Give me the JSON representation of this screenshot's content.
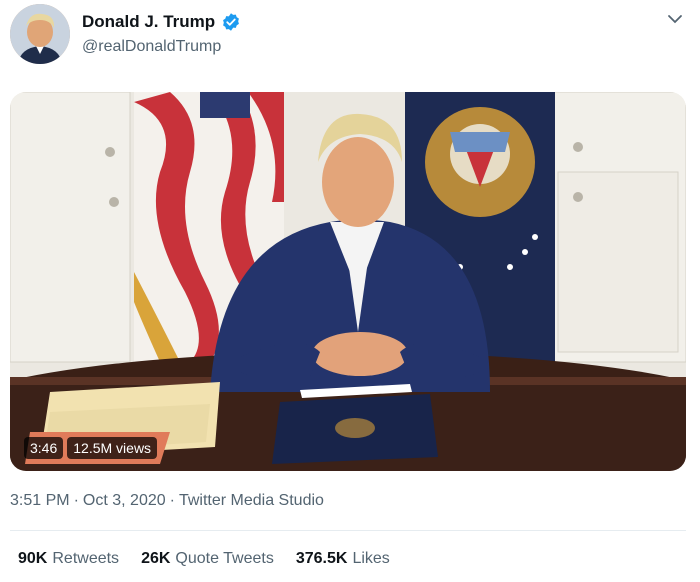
{
  "tweet": {
    "author_name": "Donald J. Trump",
    "handle": "@realDonaldTrump",
    "verified": true,
    "timestamp": "3:51 PM",
    "date": "Oct 3, 2020",
    "separator": "·",
    "source": "Twitter Media Studio"
  },
  "video": {
    "duration": "3:46",
    "views": "12.5M views"
  },
  "stats": {
    "retweets_count": "90K",
    "retweets_label": "Retweets",
    "quotes_count": "26K",
    "quotes_label": "Quote Tweets",
    "likes_count": "376.5K",
    "likes_label": "Likes"
  },
  "colors": {
    "verified": "#1d9bf0",
    "secondary_text": "#536471"
  },
  "icons": {
    "verified": "verified-badge-icon",
    "menu": "chevron-down-icon"
  }
}
